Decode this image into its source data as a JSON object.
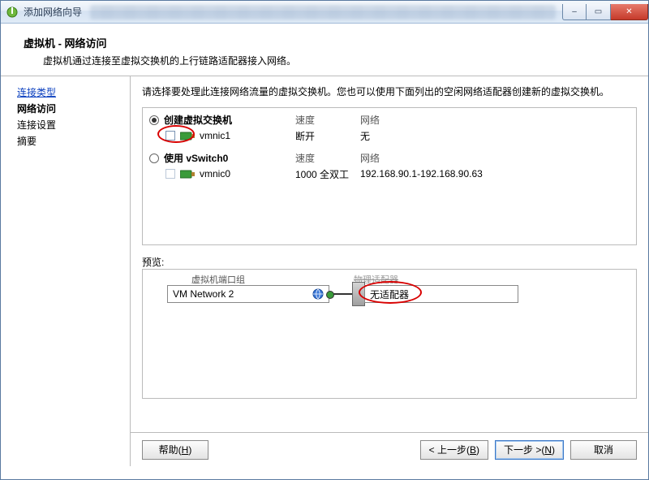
{
  "window": {
    "title": "添加网络向导",
    "minimize_icon": "–",
    "maximize_icon": "▭",
    "close_icon": "✕"
  },
  "header": {
    "title": "虚拟机 - 网络访问",
    "subtitle": "虚拟机通过连接至虚拟交换机的上行链路适配器接入网络。"
  },
  "sidebar": {
    "steps": [
      {
        "label": "连接类型",
        "link": true
      },
      {
        "label": "网络访问",
        "active": true
      },
      {
        "label": "连接设置"
      },
      {
        "label": "摘要"
      }
    ]
  },
  "main": {
    "instruction": "请选择要处理此连接网络流量的虚拟交换机。您也可以使用下面列出的空闲网络适配器创建新的虚拟交换机。",
    "col_speed": "速度",
    "col_network": "网络",
    "options": [
      {
        "radio_label": "创建虚拟交换机",
        "checked": true,
        "nic": "vmnic1",
        "speed": "断开",
        "network": "无"
      },
      {
        "radio_label": "使用 vSwitch0",
        "checked": false,
        "nic": "vmnic0",
        "speed": "1000 全双工",
        "network": "192.168.90.1-192.168.90.63"
      }
    ],
    "preview_header": "预览:",
    "preview_portgroup_label": "虚拟机端口组",
    "preview_physical_label": "物理适配器",
    "preview_portgroup_name": "VM Network 2",
    "preview_right_text": "无适配器"
  },
  "footer": {
    "help": "帮助",
    "help_key": "H",
    "back": "< 上一步",
    "back_key": "B",
    "next": "下一步 >",
    "next_key": "N",
    "cancel": "取消"
  }
}
